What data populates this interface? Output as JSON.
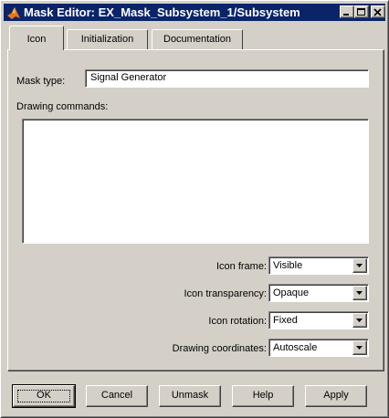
{
  "window": {
    "title": "Mask Editor: EX_Mask_Subsystem_1/Subsystem",
    "icon": "matlab-logo-icon"
  },
  "tabs": [
    {
      "label": "Icon",
      "active": true
    },
    {
      "label": "Initialization",
      "active": false
    },
    {
      "label": "Documentation",
      "active": false
    }
  ],
  "icon_tab": {
    "mask_type_label": "Mask type:",
    "mask_type_value": "Signal Generator",
    "drawing_commands_label": "Drawing commands:",
    "drawing_commands_value": "",
    "icon_frame": {
      "label": "Icon frame:",
      "value": "Visible"
    },
    "icon_transparency": {
      "label": "Icon transparency:",
      "value": "Opaque"
    },
    "icon_rotation": {
      "label": "Icon rotation:",
      "value": "Fixed"
    },
    "drawing_coordinates": {
      "label": "Drawing coordinates:",
      "value": "Autoscale"
    }
  },
  "buttons": {
    "ok": "OK",
    "cancel": "Cancel",
    "unmask": "Unmask",
    "help": "Help",
    "apply": "Apply"
  }
}
